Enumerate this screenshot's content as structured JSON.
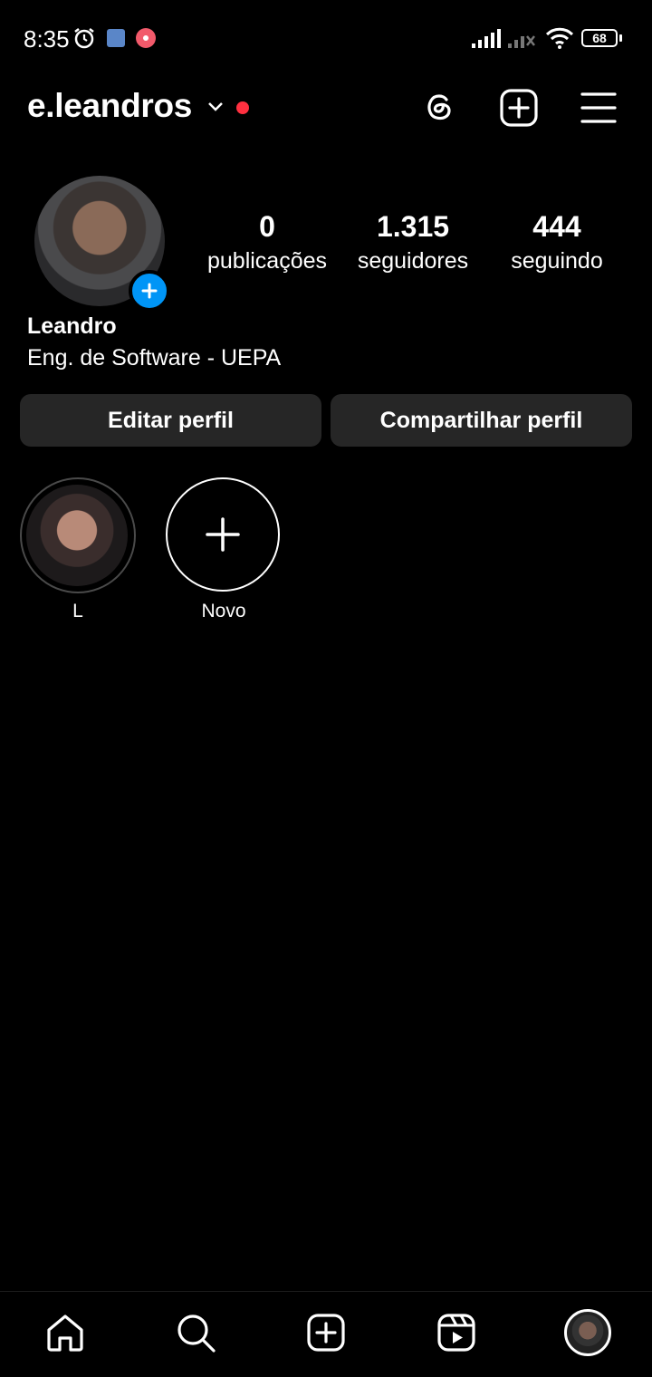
{
  "status_bar": {
    "time": "8:35",
    "battery": "68"
  },
  "header": {
    "username": "e.leandros"
  },
  "profile": {
    "stats": [
      {
        "count": "0",
        "label": "publicações"
      },
      {
        "count": "1.315",
        "label": "seguidores"
      },
      {
        "count": "444",
        "label": "seguindo"
      }
    ],
    "full_name": "Leandro",
    "bio": "Eng. de Software - UEPA"
  },
  "actions": {
    "edit": "Editar perfil",
    "share": "Compartilhar perfil"
  },
  "highlights": [
    {
      "label": "L"
    },
    {
      "label": "Novo"
    }
  ],
  "colors": {
    "accent": "#0095f6",
    "notification": "#ff3040",
    "button_bg": "#262626"
  },
  "icons": [
    "alarm-icon",
    "threads-icon",
    "new-post-icon",
    "menu-icon",
    "home-icon",
    "search-icon",
    "create-icon",
    "reels-icon"
  ]
}
